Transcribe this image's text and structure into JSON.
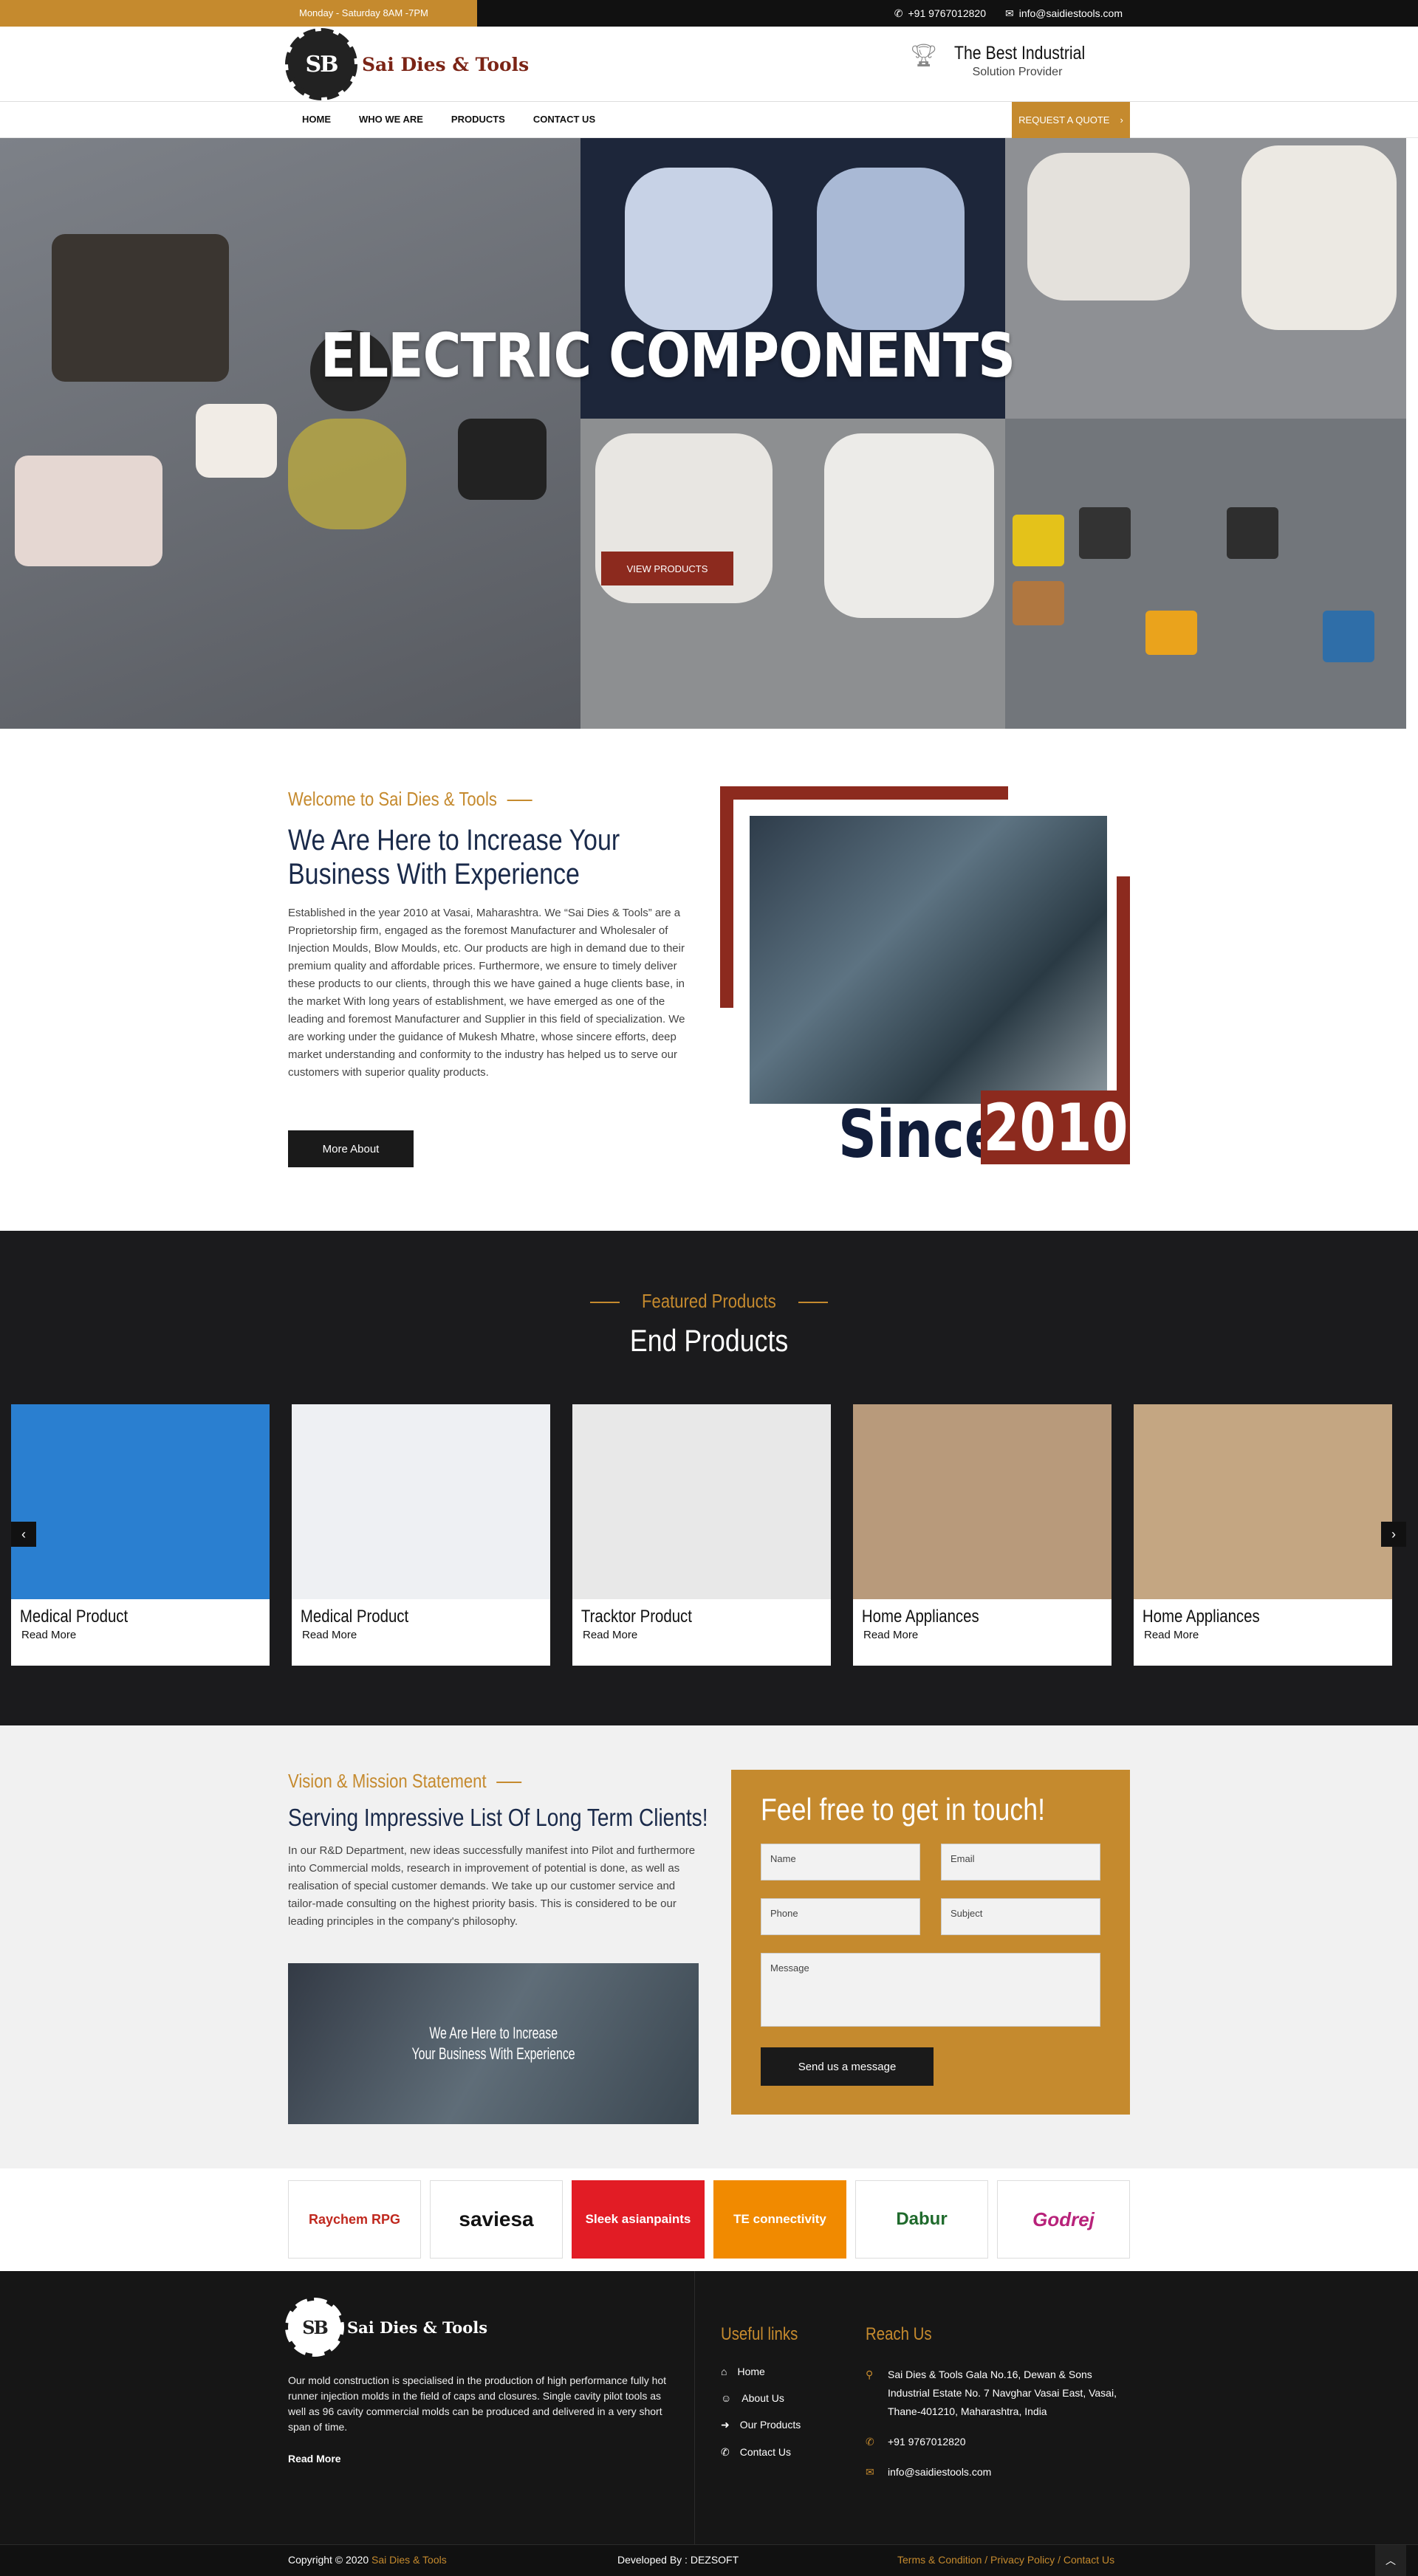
{
  "topbar": {
    "hours": "Monday - Saturday   8AM -7PM",
    "phone": "+91 9767012820",
    "email": "info@saidiestools.com",
    "phone_icon": "phone-icon",
    "email_icon": "envelope-icon"
  },
  "header": {
    "logo_mark": "SB",
    "logo_name": "Sai Dies & Tools",
    "tagline_title": "The Best Industrial",
    "tagline_sub": "Solution Provider",
    "tagline_icon": "trophy-icon"
  },
  "nav": {
    "items": [
      "HOME",
      "WHO WE ARE",
      "PRODUCTS",
      "CONTACT US"
    ],
    "quote": "REQUEST A QUOTE"
  },
  "hero": {
    "title": "ELECTRIC COMPONENTS",
    "button": "VIEW PRODUCTS"
  },
  "about": {
    "kicker": "Welcome to Sai Dies & Tools",
    "title": "We Are Here to Increase Your Business With Experience",
    "body": "Established in the year 2010 at Vasai, Maharashtra. We “Sai Dies & Tools” are a Proprietorship firm, engaged as the foremost Manufacturer and Wholesaler of Injection Moulds, Blow Moulds, etc. Our products are high in demand due to their premium quality and affordable prices. Furthermore, we ensure to timely deliver these products to our clients, through this we have gained a huge clients base, in the market With long years of establishment, we have emerged as one of the leading and foremost Manufacturer and Supplier in this field of specialization. We are working under the guidance of Mukesh Mhatre, whose sincere efforts, deep market understanding and conformity to the industry has helped us to serve our customers with superior quality products.",
    "button": "More About",
    "since": "Since",
    "year": "2010"
  },
  "products": {
    "kicker": "Featured Products",
    "title": "End Products",
    "read_more": "Read More",
    "items": [
      {
        "name": "Medical Product",
        "color": "#2a7fd0"
      },
      {
        "name": "Medical Product",
        "color": "#eef0f3"
      },
      {
        "name": "Tracktor Product",
        "color": "#e8e8e8"
      },
      {
        "name": "Home Appliances",
        "color": "#b89a7b"
      },
      {
        "name": "Home Appliances",
        "color": "#c4a682"
      }
    ]
  },
  "vision": {
    "kicker": "Vision & Mission Statement",
    "title": "Serving Impressive List Of Long Term Clients!",
    "body": "In our R&D Department, new ideas successfully manifest into Pilot and furthermore into Commercial molds, research in improvement of potential is done, as well as realisation of special customer demands. We take up our customer service and tailor-made consulting on the highest priority basis. This is considered to be our leading principles in the company's philosophy.",
    "video_line1": "We Are Here to Increase",
    "video_line2": "Your Business With Experience"
  },
  "contact": {
    "title": "Feel free to get in touch!",
    "name": "Name",
    "email": "Email",
    "phone": "Phone",
    "subject": "Subject",
    "message": "Message",
    "button": "Send us a message"
  },
  "clients": [
    "Raychem RPG",
    "saviesa",
    "Sleek asianpaints",
    "TE connectivity",
    "Dabur",
    "Godrej"
  ],
  "footer": {
    "about": "Our mold construction is specialised in the production of high performance fully hot runner injection molds in the field of caps and closures. Single cavity pilot tools as well as 96 cavity commercial molds can be produced and delivered in a very short span of time.",
    "read_more": "Read More",
    "links_title": "Useful links",
    "links": [
      "Home",
      "About Us",
      "Our Products",
      "Contact Us"
    ],
    "reach_title": "Reach Us",
    "address": "Sai Dies & Tools Gala No.16, Dewan & Sons Industrial Estate No. 7 Navghar Vasai East, Vasai, Thane-401210, Maharashtra, India",
    "phone": "+91 9767012820",
    "email": "info@saidiestools.com"
  },
  "bottom": {
    "copy": "Copyright © 2020 ",
    "copy_link": "Sai Dies & Tools",
    "dev": "Developed By : DEZSOFT",
    "legal": "Terms & Condition  / Privacy Policy  / Contact Us"
  },
  "colors": {
    "accent": "#c58a2e",
    "brand_red": "#8c2a1e",
    "navy": "#1a2a4a"
  }
}
